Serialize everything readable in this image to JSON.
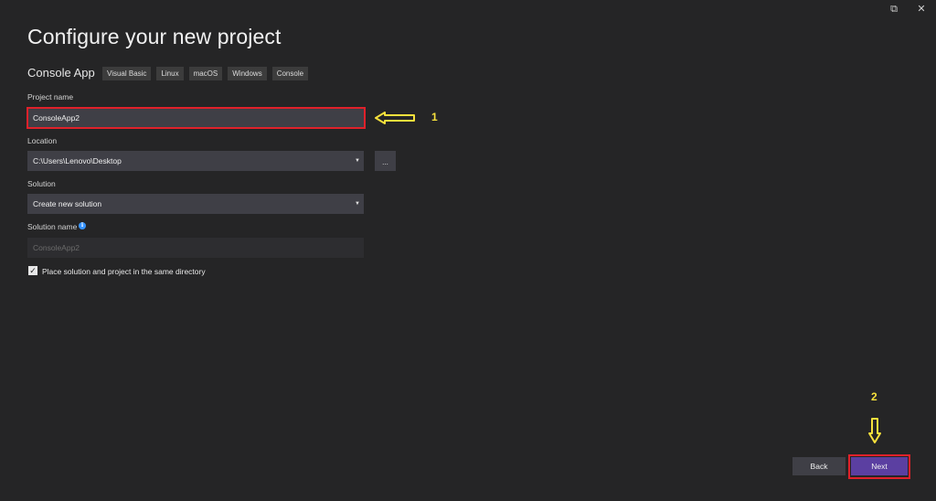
{
  "window": {
    "restore_glyph": "⧉",
    "close_glyph": "✕"
  },
  "page": {
    "title": "Configure your new project",
    "template_name": "Console App",
    "tags": [
      "Visual Basic",
      "Linux",
      "macOS",
      "Windows",
      "Console"
    ]
  },
  "form": {
    "project_name_label": "Project name",
    "project_name_value": "ConsoleApp2",
    "location_label": "Location",
    "location_value": "C:\\Users\\Lenovo\\Desktop",
    "browse_label": "...",
    "solution_label": "Solution",
    "solution_value": "Create new solution",
    "solution_name_label": "Solution name",
    "solution_name_value": "ConsoleApp2",
    "same_dir_label": "Place solution and project in the same directory",
    "same_dir_checked": true
  },
  "footer": {
    "back_label": "Back",
    "next_label": "Next"
  },
  "annotations": {
    "marker_1": "1",
    "marker_2": "2",
    "color": "#f7e13c",
    "highlight_color": "#e0212a"
  },
  "colors": {
    "background": "#252526",
    "field": "#3f3f46",
    "accent": "#5b3fa1"
  }
}
